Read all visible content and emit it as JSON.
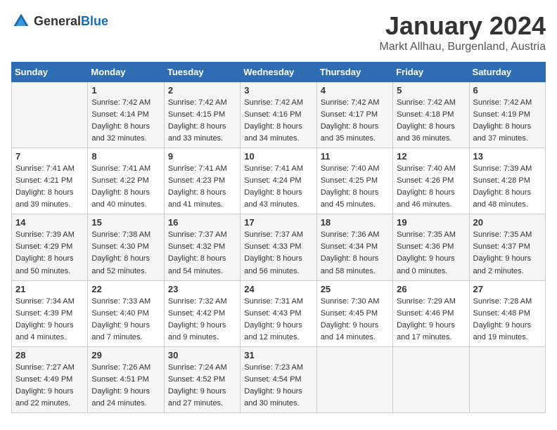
{
  "header": {
    "logo_general": "General",
    "logo_blue": "Blue",
    "title": "January 2024",
    "subtitle": "Markt Allhau, Burgenland, Austria"
  },
  "days_of_week": [
    "Sunday",
    "Monday",
    "Tuesday",
    "Wednesday",
    "Thursday",
    "Friday",
    "Saturday"
  ],
  "weeks": [
    [
      {
        "day": "",
        "sunrise": "",
        "sunset": "",
        "daylight": ""
      },
      {
        "day": "1",
        "sunrise": "Sunrise: 7:42 AM",
        "sunset": "Sunset: 4:14 PM",
        "daylight": "Daylight: 8 hours and 32 minutes."
      },
      {
        "day": "2",
        "sunrise": "Sunrise: 7:42 AM",
        "sunset": "Sunset: 4:15 PM",
        "daylight": "Daylight: 8 hours and 33 minutes."
      },
      {
        "day": "3",
        "sunrise": "Sunrise: 7:42 AM",
        "sunset": "Sunset: 4:16 PM",
        "daylight": "Daylight: 8 hours and 34 minutes."
      },
      {
        "day": "4",
        "sunrise": "Sunrise: 7:42 AM",
        "sunset": "Sunset: 4:17 PM",
        "daylight": "Daylight: 8 hours and 35 minutes."
      },
      {
        "day": "5",
        "sunrise": "Sunrise: 7:42 AM",
        "sunset": "Sunset: 4:18 PM",
        "daylight": "Daylight: 8 hours and 36 minutes."
      },
      {
        "day": "6",
        "sunrise": "Sunrise: 7:42 AM",
        "sunset": "Sunset: 4:19 PM",
        "daylight": "Daylight: 8 hours and 37 minutes."
      }
    ],
    [
      {
        "day": "7",
        "sunrise": "Sunrise: 7:41 AM",
        "sunset": "Sunset: 4:21 PM",
        "daylight": "Daylight: 8 hours and 39 minutes."
      },
      {
        "day": "8",
        "sunrise": "Sunrise: 7:41 AM",
        "sunset": "Sunset: 4:22 PM",
        "daylight": "Daylight: 8 hours and 40 minutes."
      },
      {
        "day": "9",
        "sunrise": "Sunrise: 7:41 AM",
        "sunset": "Sunset: 4:23 PM",
        "daylight": "Daylight: 8 hours and 41 minutes."
      },
      {
        "day": "10",
        "sunrise": "Sunrise: 7:41 AM",
        "sunset": "Sunset: 4:24 PM",
        "daylight": "Daylight: 8 hours and 43 minutes."
      },
      {
        "day": "11",
        "sunrise": "Sunrise: 7:40 AM",
        "sunset": "Sunset: 4:25 PM",
        "daylight": "Daylight: 8 hours and 45 minutes."
      },
      {
        "day": "12",
        "sunrise": "Sunrise: 7:40 AM",
        "sunset": "Sunset: 4:26 PM",
        "daylight": "Daylight: 8 hours and 46 minutes."
      },
      {
        "day": "13",
        "sunrise": "Sunrise: 7:39 AM",
        "sunset": "Sunset: 4:28 PM",
        "daylight": "Daylight: 8 hours and 48 minutes."
      }
    ],
    [
      {
        "day": "14",
        "sunrise": "Sunrise: 7:39 AM",
        "sunset": "Sunset: 4:29 PM",
        "daylight": "Daylight: 8 hours and 50 minutes."
      },
      {
        "day": "15",
        "sunrise": "Sunrise: 7:38 AM",
        "sunset": "Sunset: 4:30 PM",
        "daylight": "Daylight: 8 hours and 52 minutes."
      },
      {
        "day": "16",
        "sunrise": "Sunrise: 7:37 AM",
        "sunset": "Sunset: 4:32 PM",
        "daylight": "Daylight: 8 hours and 54 minutes."
      },
      {
        "day": "17",
        "sunrise": "Sunrise: 7:37 AM",
        "sunset": "Sunset: 4:33 PM",
        "daylight": "Daylight: 8 hours and 56 minutes."
      },
      {
        "day": "18",
        "sunrise": "Sunrise: 7:36 AM",
        "sunset": "Sunset: 4:34 PM",
        "daylight": "Daylight: 8 hours and 58 minutes."
      },
      {
        "day": "19",
        "sunrise": "Sunrise: 7:35 AM",
        "sunset": "Sunset: 4:36 PM",
        "daylight": "Daylight: 9 hours and 0 minutes."
      },
      {
        "day": "20",
        "sunrise": "Sunrise: 7:35 AM",
        "sunset": "Sunset: 4:37 PM",
        "daylight": "Daylight: 9 hours and 2 minutes."
      }
    ],
    [
      {
        "day": "21",
        "sunrise": "Sunrise: 7:34 AM",
        "sunset": "Sunset: 4:39 PM",
        "daylight": "Daylight: 9 hours and 4 minutes."
      },
      {
        "day": "22",
        "sunrise": "Sunrise: 7:33 AM",
        "sunset": "Sunset: 4:40 PM",
        "daylight": "Daylight: 9 hours and 7 minutes."
      },
      {
        "day": "23",
        "sunrise": "Sunrise: 7:32 AM",
        "sunset": "Sunset: 4:42 PM",
        "daylight": "Daylight: 9 hours and 9 minutes."
      },
      {
        "day": "24",
        "sunrise": "Sunrise: 7:31 AM",
        "sunset": "Sunset: 4:43 PM",
        "daylight": "Daylight: 9 hours and 12 minutes."
      },
      {
        "day": "25",
        "sunrise": "Sunrise: 7:30 AM",
        "sunset": "Sunset: 4:45 PM",
        "daylight": "Daylight: 9 hours and 14 minutes."
      },
      {
        "day": "26",
        "sunrise": "Sunrise: 7:29 AM",
        "sunset": "Sunset: 4:46 PM",
        "daylight": "Daylight: 9 hours and 17 minutes."
      },
      {
        "day": "27",
        "sunrise": "Sunrise: 7:28 AM",
        "sunset": "Sunset: 4:48 PM",
        "daylight": "Daylight: 9 hours and 19 minutes."
      }
    ],
    [
      {
        "day": "28",
        "sunrise": "Sunrise: 7:27 AM",
        "sunset": "Sunset: 4:49 PM",
        "daylight": "Daylight: 9 hours and 22 minutes."
      },
      {
        "day": "29",
        "sunrise": "Sunrise: 7:26 AM",
        "sunset": "Sunset: 4:51 PM",
        "daylight": "Daylight: 9 hours and 24 minutes."
      },
      {
        "day": "30",
        "sunrise": "Sunrise: 7:24 AM",
        "sunset": "Sunset: 4:52 PM",
        "daylight": "Daylight: 9 hours and 27 minutes."
      },
      {
        "day": "31",
        "sunrise": "Sunrise: 7:23 AM",
        "sunset": "Sunset: 4:54 PM",
        "daylight": "Daylight: 9 hours and 30 minutes."
      },
      {
        "day": "",
        "sunrise": "",
        "sunset": "",
        "daylight": ""
      },
      {
        "day": "",
        "sunrise": "",
        "sunset": "",
        "daylight": ""
      },
      {
        "day": "",
        "sunrise": "",
        "sunset": "",
        "daylight": ""
      }
    ]
  ]
}
